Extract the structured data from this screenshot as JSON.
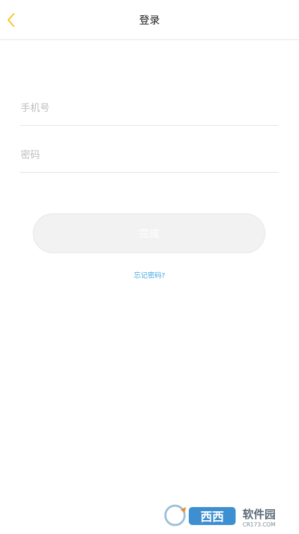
{
  "header": {
    "title": "登录",
    "back_icon": "chevron-left-icon",
    "accent_color": "#f5c518"
  },
  "form": {
    "phone_placeholder": "手机号",
    "password_placeholder": "密码",
    "submit_label": "完成",
    "forgot_label": "忘记密码?",
    "link_color": "#3fa8e0"
  },
  "watermark": {
    "brand_text": "西西软件园",
    "domain_text": "CR173.COM"
  }
}
